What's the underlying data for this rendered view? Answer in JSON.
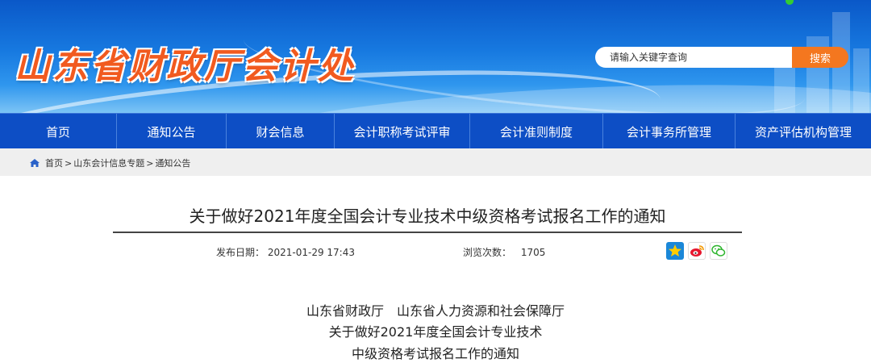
{
  "header": {
    "site_title": "山东省财政厅会计处",
    "search": {
      "placeholder": "请输入关键字查询",
      "button_label": "搜索"
    }
  },
  "nav": {
    "items": [
      {
        "label": "首页"
      },
      {
        "label": "通知公告"
      },
      {
        "label": "财会信息"
      },
      {
        "label": "会计职称考试评审"
      },
      {
        "label": "会计准则制度"
      },
      {
        "label": "会计事务所管理"
      },
      {
        "label": "资产评估机构管理"
      }
    ]
  },
  "breadcrumb": {
    "items": [
      "首页",
      "山东会计信息专题",
      "通知公告"
    ],
    "separator": ">"
  },
  "article": {
    "title": "关于做好2021年度全国会计专业技术中级资格考试报名工作的通知",
    "publish_label": "发布日期：",
    "publish_date": "2021-01-29 17:43",
    "views_label": "浏览次数：",
    "views": "1705",
    "body_lines": [
      "山东省财政厅　山东省人力资源和社会保障厅",
      "关于做好2021年度全国会计专业技术",
      "中级资格考试报名工作的通知"
    ]
  },
  "colors": {
    "nav_bg": "#0d4ec5",
    "title_orange": "#f15a1f",
    "search_button": "#f4771f"
  }
}
